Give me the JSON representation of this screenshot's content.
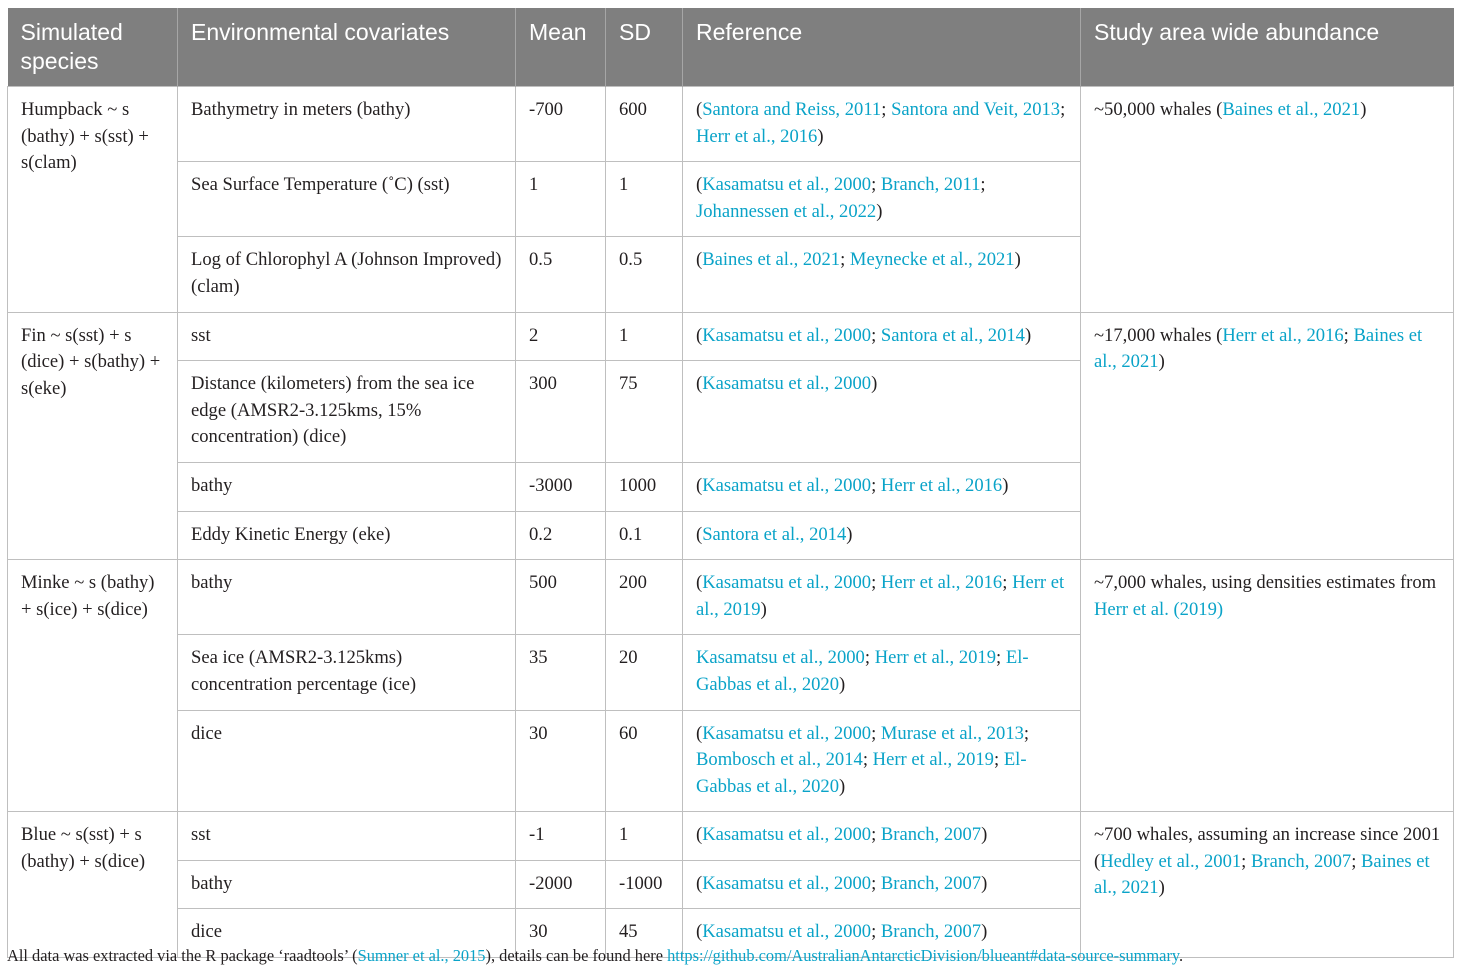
{
  "headers": [
    "Simulated species",
    "Environmental covariates",
    "Mean",
    "SD",
    "Reference",
    "Study area wide abundance"
  ],
  "groups": [
    {
      "species": "Humpback ~ s (bathy) + s(sst) + s(clam)",
      "abundance": [
        {
          "t": "~50,000 whales ("
        },
        {
          "t": "Baines et al., 2021",
          "ref": true
        },
        {
          "t": ")"
        }
      ],
      "rows": [
        {
          "covariate": "Bathymetry in meters (bathy)",
          "mean": "-700",
          "sd": "600",
          "reference": [
            {
              "t": "("
            },
            {
              "t": "Santora and Reiss, 2011",
              "ref": true
            },
            {
              "t": "; "
            },
            {
              "t": "Santora and Veit, 2013",
              "ref": true
            },
            {
              "t": "; "
            },
            {
              "t": "Herr et al., 2016",
              "ref": true
            },
            {
              "t": ")"
            }
          ]
        },
        {
          "covariate": "Sea Surface Temperature (˚C) (sst)",
          "mean": "1",
          "sd": "1",
          "reference": [
            {
              "t": "("
            },
            {
              "t": "Kasamatsu et al., 2000",
              "ref": true
            },
            {
              "t": "; "
            },
            {
              "t": "Branch, 2011",
              "ref": true
            },
            {
              "t": "; "
            },
            {
              "t": "Johannessen et al., 2022",
              "ref": true
            },
            {
              "t": ")"
            }
          ]
        },
        {
          "covariate": "Log of Chlorophyl A (Johnson Improved) (clam)",
          "mean": "0.5",
          "sd": "0.5",
          "reference": [
            {
              "t": "("
            },
            {
              "t": "Baines et al., 2021",
              "ref": true
            },
            {
              "t": "; "
            },
            {
              "t": "Meynecke et al., 2021",
              "ref": true
            },
            {
              "t": ")"
            }
          ]
        }
      ]
    },
    {
      "species": "Fin ~ s(sst) + s (dice) + s(bathy) + s(eke)",
      "abundance": [
        {
          "t": "~17,000 whales ("
        },
        {
          "t": "Herr et al., 2016",
          "ref": true
        },
        {
          "t": "; "
        },
        {
          "t": "Baines et al., 2021",
          "ref": true
        },
        {
          "t": ")"
        }
      ],
      "rows": [
        {
          "covariate": "sst",
          "mean": "2",
          "sd": "1",
          "reference": [
            {
              "t": "("
            },
            {
              "t": "Kasamatsu et al., 2000",
              "ref": true
            },
            {
              "t": "; "
            },
            {
              "t": "Santora et al., 2014",
              "ref": true
            },
            {
              "t": ")"
            }
          ]
        },
        {
          "covariate": "Distance (kilometers) from the sea ice edge (AMSR2-3.125kms, 15% concentration) (dice)",
          "mean": "300",
          "sd": "75",
          "reference": [
            {
              "t": "("
            },
            {
              "t": "Kasamatsu et al., 2000",
              "ref": true
            },
            {
              "t": ")"
            }
          ]
        },
        {
          "covariate": "bathy",
          "mean": "-3000",
          "sd": "1000",
          "reference": [
            {
              "t": "("
            },
            {
              "t": "Kasamatsu et al., 2000",
              "ref": true
            },
            {
              "t": "; "
            },
            {
              "t": "Herr et al., 2016",
              "ref": true
            },
            {
              "t": ")"
            }
          ]
        },
        {
          "covariate": "Eddy Kinetic Energy (eke)",
          "mean": "0.2",
          "sd": "0.1",
          "reference": [
            {
              "t": "("
            },
            {
              "t": "Santora et al., 2014",
              "ref": true
            },
            {
              "t": ")"
            }
          ]
        }
      ]
    },
    {
      "species": "Minke ~ s (bathy) + s(ice) + s(dice)",
      "abundance": [
        {
          "t": "~7,000 whales, using densities estimates from "
        },
        {
          "t": "Herr et al. (2019)",
          "ref": true
        }
      ],
      "rows": [
        {
          "covariate": "bathy",
          "mean": "500",
          "sd": "200",
          "reference": [
            {
              "t": "("
            },
            {
              "t": "Kasamatsu et al., 2000",
              "ref": true
            },
            {
              "t": "; "
            },
            {
              "t": "Herr et al., 2016",
              "ref": true
            },
            {
              "t": "; "
            },
            {
              "t": "Herr et al., 2019",
              "ref": true
            },
            {
              "t": ")"
            }
          ]
        },
        {
          "covariate": "Sea ice (AMSR2-3.125kms) concentration percentage (ice)",
          "mean": "35",
          "sd": "20",
          "reference": [
            {
              "t": "Kasamatsu et al., 2000",
              "ref": true
            },
            {
              "t": "; "
            },
            {
              "t": "Herr et al., 2019",
              "ref": true
            },
            {
              "t": "; "
            },
            {
              "t": "El-Gabbas et al., 2020",
              "ref": true
            },
            {
              "t": ")"
            }
          ]
        },
        {
          "covariate": "dice",
          "mean": "30",
          "sd": "60",
          "reference": [
            {
              "t": "("
            },
            {
              "t": "Kasamatsu et al., 2000",
              "ref": true
            },
            {
              "t": "; "
            },
            {
              "t": "Murase et al., 2013",
              "ref": true
            },
            {
              "t": "; "
            },
            {
              "t": "Bombosch et al., 2014",
              "ref": true
            },
            {
              "t": "; "
            },
            {
              "t": "Herr et al., 2019",
              "ref": true
            },
            {
              "t": "; "
            },
            {
              "t": "El-Gabbas et al., 2020",
              "ref": true
            },
            {
              "t": ")"
            }
          ]
        }
      ]
    },
    {
      "species": "Blue ~ s(sst) + s (bathy) + s(dice)",
      "abundance": [
        {
          "t": "~700 whales, assuming an increase since 2001 ("
        },
        {
          "t": "Hedley et al., 2001",
          "ref": true
        },
        {
          "t": "; "
        },
        {
          "t": "Branch, 2007",
          "ref": true
        },
        {
          "t": "; "
        },
        {
          "t": "Baines et al., 2021",
          "ref": true
        },
        {
          "t": ")"
        }
      ],
      "rows": [
        {
          "covariate": "sst",
          "mean": "-1",
          "sd": "1",
          "reference": [
            {
              "t": "("
            },
            {
              "t": "Kasamatsu et al., 2000",
              "ref": true
            },
            {
              "t": "; "
            },
            {
              "t": "Branch, 2007",
              "ref": true
            },
            {
              "t": ")"
            }
          ]
        },
        {
          "covariate": "bathy",
          "mean": "-2000",
          "sd": "-1000",
          "reference": [
            {
              "t": "("
            },
            {
              "t": "Kasamatsu et al., 2000",
              "ref": true
            },
            {
              "t": "; "
            },
            {
              "t": "Branch, 2007",
              "ref": true
            },
            {
              "t": ")"
            }
          ]
        },
        {
          "covariate": "dice",
          "mean": "30",
          "sd": "45",
          "reference": [
            {
              "t": "("
            },
            {
              "t": "Kasamatsu et al., 2000",
              "ref": true
            },
            {
              "t": "; "
            },
            {
              "t": "Branch, 2007",
              "ref": true
            },
            {
              "t": ")"
            }
          ]
        }
      ]
    }
  ],
  "footnote": [
    {
      "t": "All data was extracted via the R package ‘raadtools’ ("
    },
    {
      "t": "Sumner et al., 2015",
      "ref": true
    },
    {
      "t": "), details can be found here "
    },
    {
      "t": "https://github.com/AustralianAntarcticDivision/blueant#data-source-summary",
      "ref": true
    },
    {
      "t": "."
    }
  ],
  "colors": {
    "header_bg": "#7f7f7f",
    "header_text": "#ffffff",
    "link": "#0aa3c8",
    "border": "#bfbfbf"
  }
}
